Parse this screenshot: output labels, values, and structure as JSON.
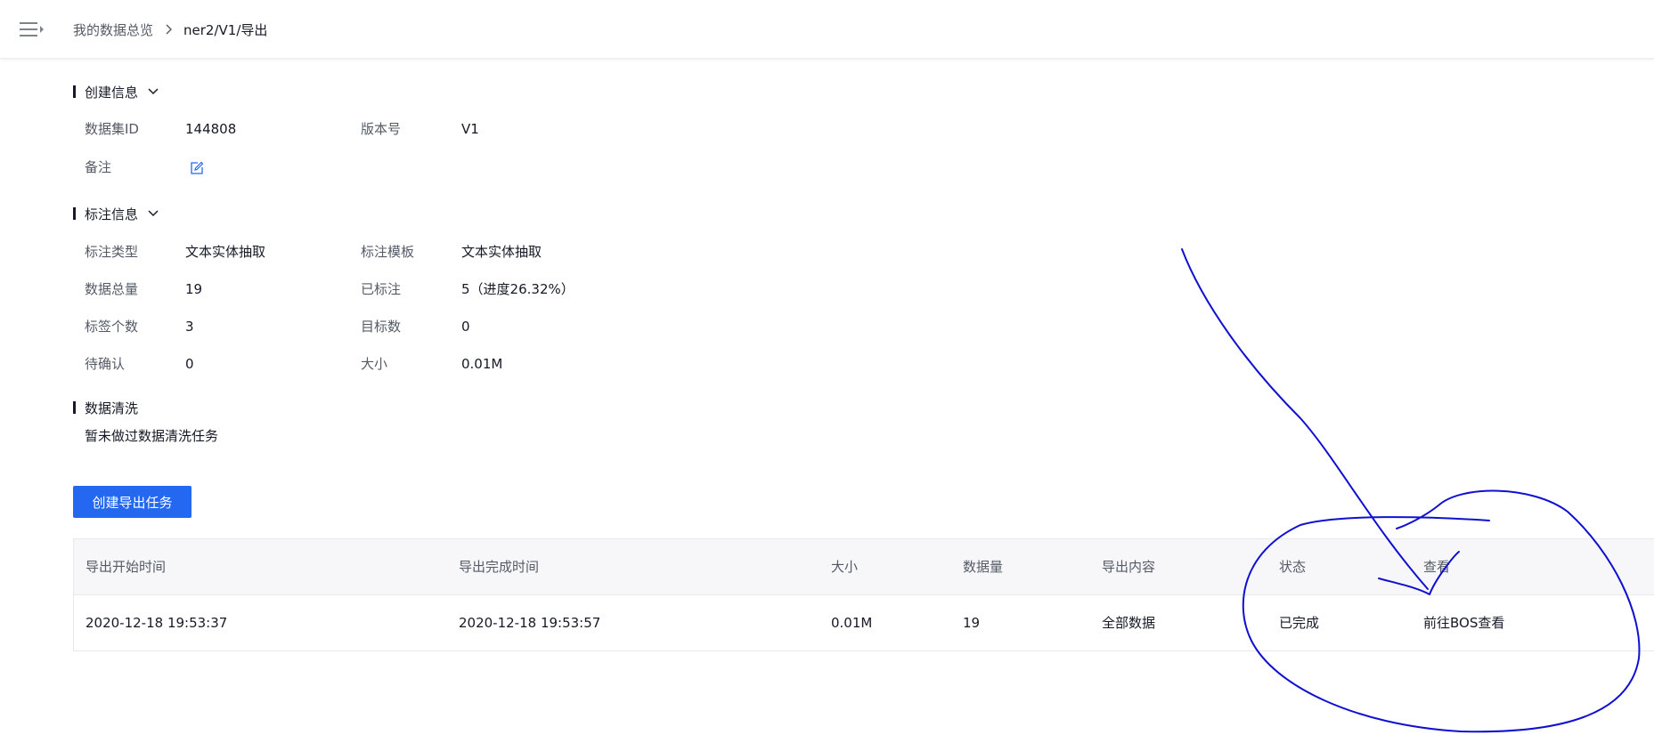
{
  "breadcrumb": {
    "root": "我的数据总览",
    "current": "ner2/V1/导出"
  },
  "creation_info": {
    "title": "创建信息",
    "dataset_id_label": "数据集ID",
    "dataset_id_value": "144808",
    "version_label": "版本号",
    "version_value": "V1",
    "remark_label": "备注"
  },
  "annotation_info": {
    "title": "标注信息",
    "type_label": "标注类型",
    "type_value": "文本实体抽取",
    "template_label": "标注模板",
    "template_value": "文本实体抽取",
    "total_label": "数据总量",
    "total_value": "19",
    "labeled_label": "已标注",
    "labeled_value": "5（进度26.32%）",
    "tag_count_label": "标签个数",
    "tag_count_value": "3",
    "target_count_label": "目标数",
    "target_count_value": "0",
    "pending_label": "待确认",
    "pending_value": "0",
    "size_label": "大小",
    "size_value": "0.01M"
  },
  "cleaning": {
    "title": "数据清洗",
    "empty_text": "暂未做过数据清洗任务"
  },
  "actions": {
    "create_export_label": "创建导出任务"
  },
  "table": {
    "columns": [
      "导出开始时间",
      "导出完成时间",
      "大小",
      "数据量",
      "导出内容",
      "状态",
      "查看"
    ],
    "rows": [
      {
        "start_time": "2020-12-18 19:53:37",
        "end_time": "2020-12-18 19:53:57",
        "size": "0.01M",
        "count": "19",
        "content": "全部数据",
        "status": "已完成",
        "view_link": "前往BOS查看"
      }
    ]
  },
  "colors": {
    "primary": "#2468f2",
    "text": "#151a26",
    "label": "#545b66",
    "annotation_ink": "#1010d0"
  },
  "icons": {
    "menu": "menu-toggle-icon",
    "breadcrumb_separator": "chevron-right-icon",
    "section_collapse": "chevron-down-icon",
    "remark_edit": "edit-icon"
  }
}
